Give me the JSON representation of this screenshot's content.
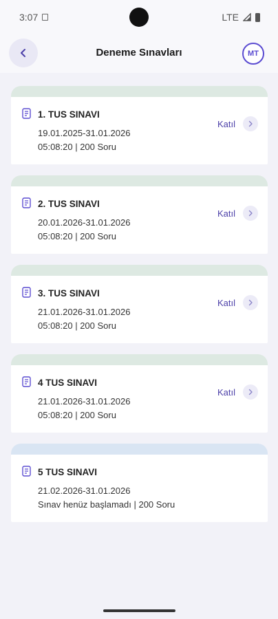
{
  "status_bar": {
    "time": "3:07",
    "network": "LTE"
  },
  "header": {
    "title": "Deneme Sınavları",
    "logo_text": "MT"
  },
  "exams": [
    {
      "title": "1. TUS SINAVI",
      "dates": "19.01.2025-31.01.2026",
      "meta": "05:08:20 | 200 Soru",
      "action": "Katıl",
      "band": "green"
    },
    {
      "title": "2. TUS SINAVI",
      "dates": "20.01.2026-31.01.2026",
      "meta": "05:08:20 | 200 Soru",
      "action": "Katıl",
      "band": "green"
    },
    {
      "title": "3. TUS SINAVI",
      "dates": "21.01.2026-31.01.2026",
      "meta": "05:08:20 | 200 Soru",
      "action": "Katıl",
      "band": "green"
    },
    {
      "title": "4 TUS SINAVI",
      "dates": "21.01.2026-31.01.2026",
      "meta": "05:08:20 | 200 Soru",
      "action": "Katıl",
      "band": "green"
    },
    {
      "title": "5 TUS SINAVI",
      "dates": "21.02.2026-31.01.2026",
      "meta": "Sınav henüz başlamadı | 200 Soru",
      "action": "",
      "band": "blue"
    }
  ],
  "icons": {
    "back": "chevron-left-icon",
    "exam": "document-icon",
    "join": "chevron-right-icon"
  },
  "colors": {
    "accent": "#4b3fa8",
    "active_band": "#dde9e2",
    "pending_band": "#d9e5f3",
    "background": "#f2f2f8"
  }
}
